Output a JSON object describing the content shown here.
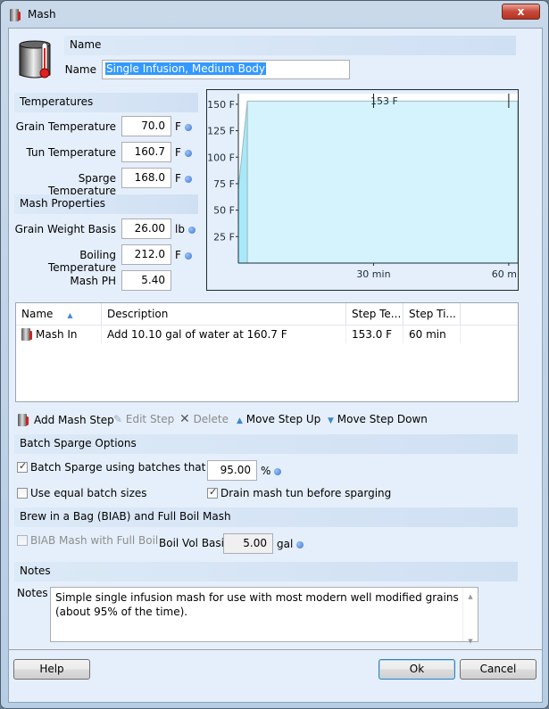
{
  "window": {
    "title": "Mash",
    "close_label": "x"
  },
  "name_section": {
    "header": "Name",
    "label": "Name",
    "value": "Single Infusion, Medium Body"
  },
  "temperatures": {
    "header": "Temperatures",
    "fields": [
      {
        "label": "Grain Temperature",
        "value": "70.0",
        "unit": "F"
      },
      {
        "label": "Tun Temperature",
        "value": "160.7",
        "unit": "F"
      },
      {
        "label": "Sparge Temperature",
        "value": "168.0",
        "unit": "F"
      }
    ]
  },
  "mash_properties": {
    "header": "Mash Properties",
    "fields": [
      {
        "label": "Grain Weight Basis",
        "value": "26.00",
        "unit": "lb"
      },
      {
        "label": "Boiling Temperature",
        "value": "212.0",
        "unit": "F"
      },
      {
        "label": "Mash PH",
        "value": "5.40",
        "unit": ""
      }
    ]
  },
  "chart_data": {
    "type": "area",
    "title": "",
    "xlabel": "",
    "ylabel": "",
    "y_ticks": [
      "25 F",
      "50 F",
      "75 F",
      "100 F",
      "125 F",
      "150 F"
    ],
    "x_ticks": [
      "30 min",
      "60 min"
    ],
    "ylim": [
      0,
      160
    ],
    "xlim": [
      0,
      62
    ],
    "annotation": "153 F",
    "series": [
      {
        "name": "Mash In",
        "points": [
          [
            0,
            70
          ],
          [
            2,
            153
          ],
          [
            62,
            153
          ]
        ]
      }
    ],
    "step_marker_x": [
      30,
      60
    ]
  },
  "steps_table": {
    "columns": [
      "Name",
      "Description",
      "Step Te...",
      "Step Ti..."
    ],
    "rows": [
      {
        "name": "Mash In",
        "description": "Add 10.10 gal of water at 160.7 F",
        "temp": "153.0 F",
        "time": "60 min"
      }
    ]
  },
  "toolbar": {
    "add": "Add Mash Step",
    "edit": "Edit Step",
    "delete": "Delete",
    "up": "Move Step Up",
    "down": "Move Step Down"
  },
  "batch_sparge": {
    "header": "Batch Sparge Options",
    "fill_label": "Batch Sparge using batches that fill",
    "fill_value": "95.00",
    "fill_unit": "%",
    "fill_checked": true,
    "equal_label": "Use equal batch sizes",
    "equal_checked": false,
    "drain_label": "Drain mash tun before sparging",
    "drain_checked": true
  },
  "biab": {
    "header": "Brew in a Bag (BIAB) and Full Boil Mash",
    "check_label": "BIAB Mash with Full Boil",
    "checked": false,
    "boil_label": "Boil Vol Basis",
    "boil_value": "5.00",
    "boil_unit": "gal"
  },
  "notes": {
    "header": "Notes",
    "label": "Notes",
    "value": "Simple single infusion mash for use with most modern well modified grains (about 95% of the time)."
  },
  "buttons": {
    "help": "Help",
    "ok": "Ok",
    "cancel": "Cancel"
  }
}
